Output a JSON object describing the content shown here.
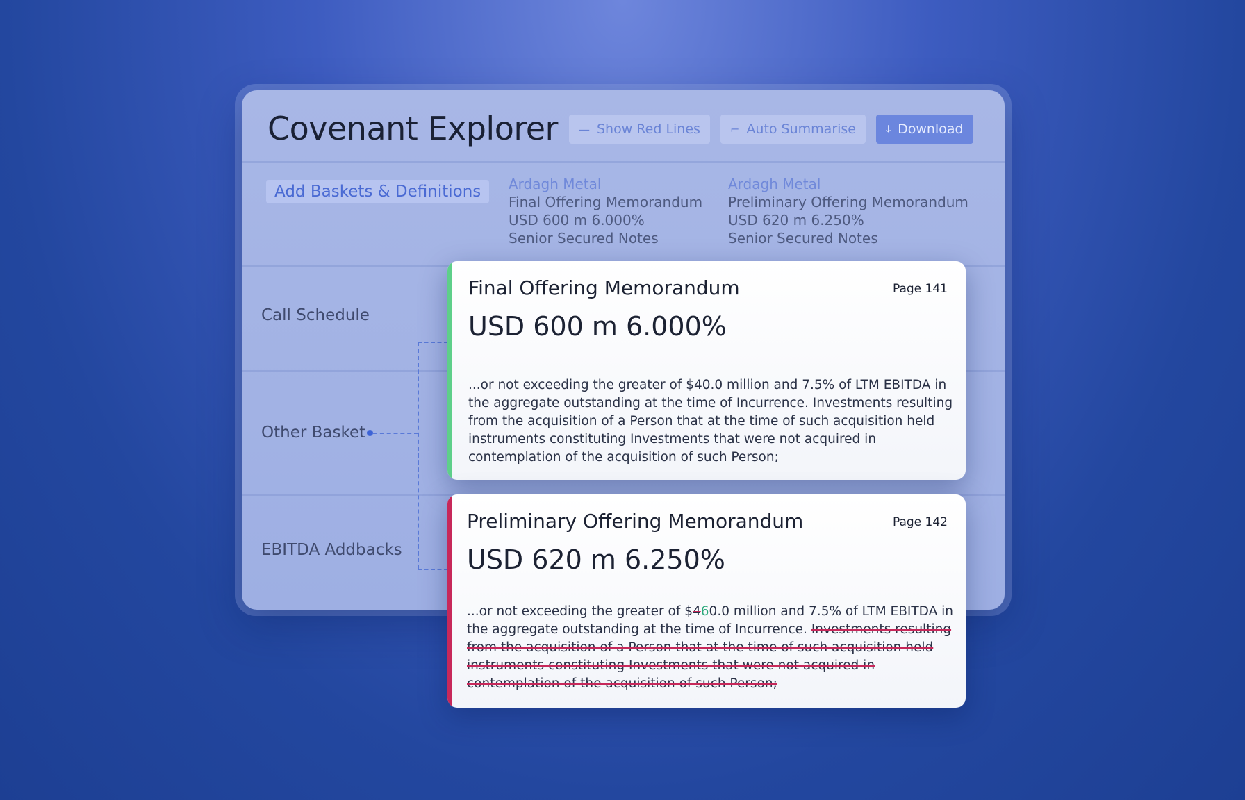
{
  "app": {
    "title": "Covenant Explorer"
  },
  "toolbar": {
    "red_lines_label": "Show Red Lines",
    "summarise_label": "Auto Summarise",
    "download_label": "Download"
  },
  "add_baskets_label": "Add Baskets & Definitions",
  "columns": [
    {
      "issuer": "Ardagh Metal",
      "document": "Final Offering Memorandum",
      "amount": "USD 600 m 6.000%",
      "notes": "Senior Secured Notes"
    },
    {
      "issuer": "Ardagh Metal",
      "document": "Preliminary Offering Memorandum",
      "amount": "USD 620 m 6.250%",
      "notes": "Senior Secured Notes"
    }
  ],
  "rows": [
    "Call Schedule",
    "Other Basket",
    "EBITDA Addbacks"
  ],
  "cards": [
    {
      "document": "Final Offering Memorandum",
      "page": "Page 141",
      "amount": "USD 600 m 6.000%",
      "text": "...or not exceeding the greater of $40.0 million and 7.5% of LTM EBITDA in the aggregate outstanding at the time of Incurrence. Investments resulting from the acquisition of a Person that at the time of such acquisition held instruments constituting Investments that were not acquired in contemplation of the acquisition of such Person;"
    },
    {
      "document": "Preliminary Offering Memorandum",
      "page": "Page 142",
      "amount": "USD 620 m 6.250%",
      "text_prefix": "...or not exceeding the greater of $",
      "deleted_digit": "4",
      "inserted_digit": "6",
      "text_mid": "0.0 million and 7.5% of LTM EBITDA in the aggregate outstanding at the time of Incurrence. ",
      "text_struck": "Investments resulting from the acquisition of a Person that at the time of such acquisition held instruments constituting Investments that were not acquired in contemplation of the acquisition of such Person;"
    }
  ],
  "colors": {
    "final_stripe": "#5ecf8a",
    "prelim_stripe": "#c7285a",
    "accent": "#6b86de"
  }
}
